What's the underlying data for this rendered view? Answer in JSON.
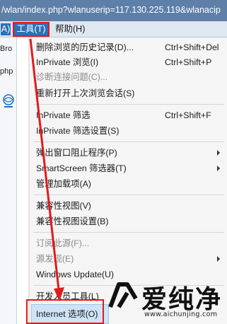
{
  "address_bar": {
    "url_fragment": "/wlan/index.php?wlanuserip=117.130.225.119&wlanacip"
  },
  "menubar": {
    "edge_item": "A)",
    "tools": "工具(T)",
    "help": "帮助(H)"
  },
  "left_pane": {
    "fragment1": "Bro",
    "fragment2": "php"
  },
  "tools_menu": {
    "items": [
      {
        "label": "删除浏览的历史记录(D)...",
        "shortcut": "Ctrl+Shift+Del",
        "disabled": false
      },
      {
        "label": "InPrivate 浏览(I)",
        "shortcut": "Ctrl+Shift+P",
        "disabled": false
      },
      {
        "label": "诊断连接问题(C)...",
        "shortcut": "",
        "disabled": true
      },
      {
        "label": "重新打开上次浏览会话(S)",
        "shortcut": "",
        "disabled": false
      },
      {
        "label": "InPrivate 筛选",
        "shortcut": "Ctrl+Shift+F",
        "disabled": false
      },
      {
        "label": "InPrivate 筛选设置(S)",
        "shortcut": "",
        "disabled": false
      },
      {
        "label": "弹出窗口阻止程序(P)",
        "shortcut": "",
        "disabled": false,
        "submenu": true
      },
      {
        "label": "SmartScreen 筛选器(T)",
        "shortcut": "",
        "disabled": false,
        "submenu": true
      },
      {
        "label": "管理加载项(A)",
        "shortcut": "",
        "disabled": false
      },
      {
        "label": "兼容性视图(V)",
        "shortcut": "",
        "disabled": false
      },
      {
        "label": "兼容性视图设置(B)",
        "shortcut": "",
        "disabled": false
      },
      {
        "label": "订阅此源(F)...",
        "shortcut": "",
        "disabled": true
      },
      {
        "label": "源发现(E)",
        "shortcut": "",
        "disabled": true,
        "submenu": true
      },
      {
        "label": "Windows Update(U)",
        "shortcut": "",
        "disabled": false
      },
      {
        "label": "开发人员工具(L)",
        "shortcut": "",
        "disabled": false
      },
      {
        "label": "Internet 选项(O)",
        "shortcut": "",
        "disabled": false
      }
    ]
  },
  "watermark": {
    "brand": "爱纯净",
    "url": "www.aichunjing.com"
  },
  "colors": {
    "annotation_red": "#e11b1b",
    "menu_bg": "#f5f5f5",
    "menubar_bg": "#dfe7f1"
  }
}
